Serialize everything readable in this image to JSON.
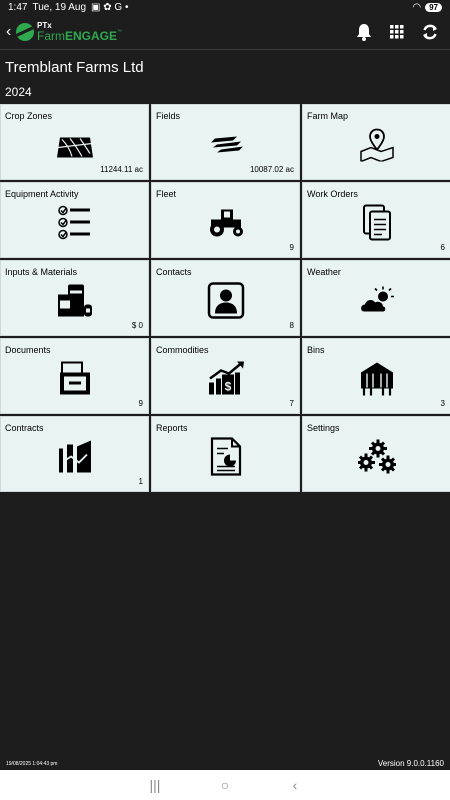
{
  "status_bar": {
    "time": "1:47",
    "date": "Tue, 19 Aug",
    "battery": "97"
  },
  "app": {
    "logo_top": "PTx",
    "logo_farm": "Farm",
    "logo_engage": "ENGAGE",
    "logo_tm": "™"
  },
  "header": {
    "farm_name": "Tremblant Farms Ltd",
    "season": "2024"
  },
  "tiles": [
    {
      "label": "Crop Zones",
      "count": "11244.11 ac",
      "icon": "crop-zones-icon"
    },
    {
      "label": "Fields",
      "count": "10087.02 ac",
      "icon": "fields-icon"
    },
    {
      "label": "Farm Map",
      "count": "",
      "icon": "farm-map-icon"
    },
    {
      "label": "Equipment Activity",
      "count": "",
      "icon": "checklist-icon"
    },
    {
      "label": "Fleet",
      "count": "9",
      "icon": "tractor-icon"
    },
    {
      "label": "Work Orders",
      "count": "6",
      "icon": "work-orders-icon"
    },
    {
      "label": "Inputs & Materials",
      "count": "$ 0",
      "icon": "inputs-icon"
    },
    {
      "label": "Contacts",
      "count": "8",
      "icon": "contacts-icon"
    },
    {
      "label": "Weather",
      "count": "",
      "icon": "weather-icon"
    },
    {
      "label": "Documents",
      "count": "9",
      "icon": "documents-icon"
    },
    {
      "label": "Commodities",
      "count": "7",
      "icon": "commodities-icon"
    },
    {
      "label": "Bins",
      "count": "3",
      "icon": "bins-icon"
    },
    {
      "label": "Contracts",
      "count": "1",
      "icon": "contracts-icon"
    },
    {
      "label": "Reports",
      "count": "",
      "icon": "reports-icon"
    },
    {
      "label": "Settings",
      "count": "",
      "icon": "settings-icon"
    }
  ],
  "footer": {
    "date": "19/08/2025 1:04:43 pm",
    "version": "Version 9.0.0.1160"
  }
}
